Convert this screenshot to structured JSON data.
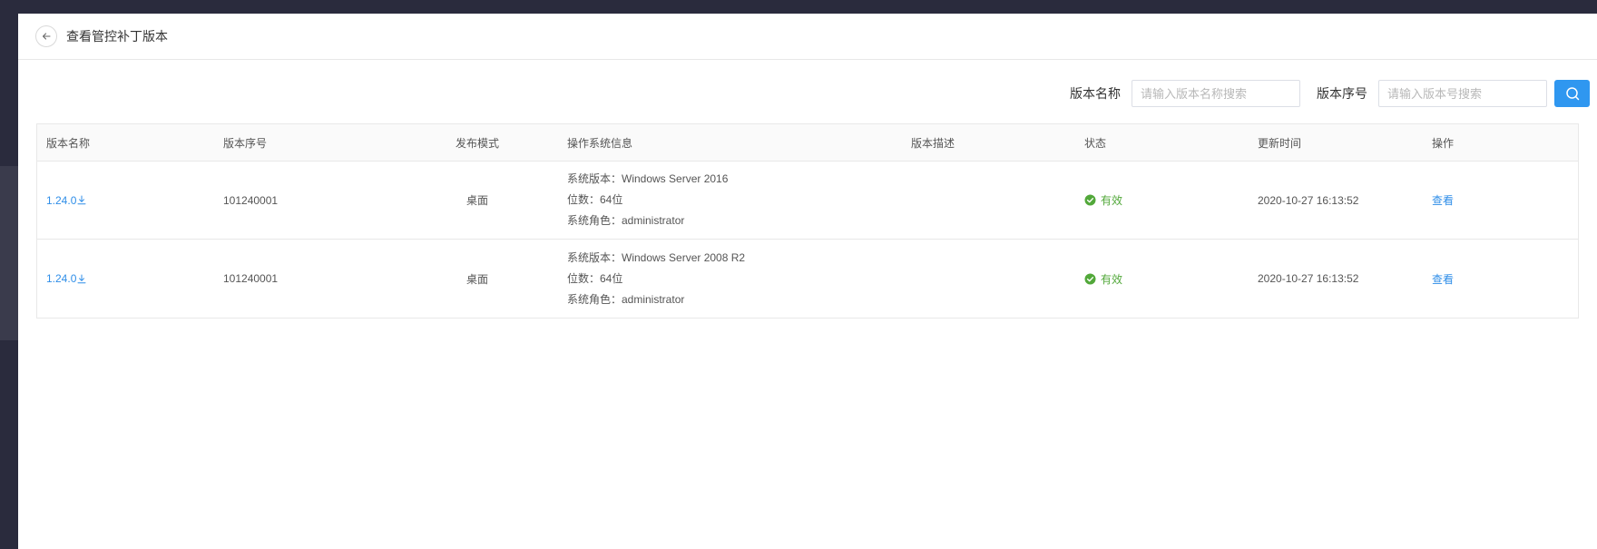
{
  "header": {
    "title": "查看管控补丁版本"
  },
  "filters": {
    "name_label": "版本名称",
    "name_placeholder": "请输入版本名称搜索",
    "name_value": "",
    "serial_label": "版本序号",
    "serial_placeholder": "请输入版本号搜索",
    "serial_value": ""
  },
  "table": {
    "columns": [
      "版本名称",
      "版本序号",
      "发布模式",
      "操作系统信息",
      "版本描述",
      "状态",
      "更新时间",
      "操作"
    ],
    "rows": [
      {
        "version_name": "1.24.0",
        "serial": "101240001",
        "mode": "桌面",
        "os_version": "系统版本：Windows Server 2016",
        "os_bits": "位数：64位",
        "os_role": "系统角色：administrator",
        "description": "",
        "status": "有效",
        "updated": "2020-10-27 16:13:52",
        "action": "查看"
      },
      {
        "version_name": "1.24.0",
        "serial": "101240001",
        "mode": "桌面",
        "os_version": "系统版本：Windows Server 2008 R2",
        "os_bits": "位数：64位",
        "os_role": "系统角色：administrator",
        "description": "",
        "status": "有效",
        "updated": "2020-10-27 16:13:52",
        "action": "查看"
      }
    ]
  },
  "icons": {
    "back": "arrow-left-icon",
    "search": "search-icon",
    "download": "download-icon",
    "status": "check-circle-icon"
  },
  "colors": {
    "accent": "#2f97f0",
    "link": "#2f8ee8",
    "success": "#52a83a",
    "backdrop": "#2a2b3d"
  }
}
